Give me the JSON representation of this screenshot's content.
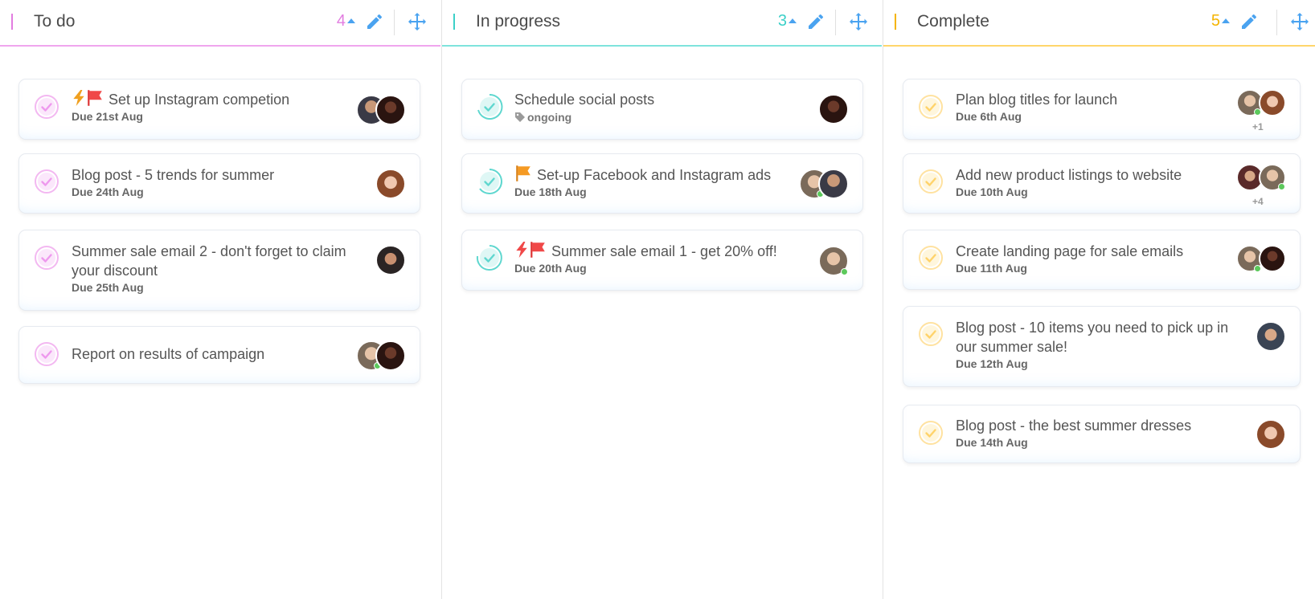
{
  "columns": [
    {
      "title": "To do",
      "count": "4",
      "accent": "#e27de0",
      "check_color": "#ee99ee",
      "cards": [
        {
          "title": "Set up Instagram competion",
          "due": "Due 21st Aug",
          "icons": [
            "lightning-icon",
            "red-flag-icon"
          ]
        },
        {
          "title": "Blog post - 5 trends for summer",
          "due": "Due 24th Aug",
          "icons": []
        },
        {
          "title_line1": "Summer sale email 2 - don't forget to claim",
          "title_line2": "your discount",
          "due": "Due 25th Aug",
          "icons": []
        },
        {
          "title": "Report on results of campaign",
          "due": "",
          "icons": []
        }
      ]
    },
    {
      "title": "In progress",
      "count": "3",
      "accent": "#3cd0c8",
      "check_color": "#5fd7cf",
      "cards": [
        {
          "title": "Schedule social posts",
          "tag": "ongoing",
          "icons": []
        },
        {
          "title": "Set-up Facebook and Instagram ads",
          "due": "Due 18th Aug",
          "icons": [
            "orange-flag-icon"
          ]
        },
        {
          "title": "Summer sale email 1 - get 20% off!",
          "due": "Due 20th Aug",
          "icons": [
            "lightning-icon",
            "red-flag-icon"
          ]
        }
      ]
    },
    {
      "title": "Complete",
      "count": "5",
      "accent": "#f5b400",
      "check_color": "#ffd36a",
      "cards": [
        {
          "title": "Plan blog titles for launch",
          "due": "Due 6th Aug",
          "more": "+1"
        },
        {
          "title": "Add new product listings to website",
          "due": "Due 10th Aug",
          "more": "+4"
        },
        {
          "title": "Create landing page for sale emails",
          "due": "Due 11th Aug"
        },
        {
          "title_line1": "Blog post - 10 items you need to pick up in",
          "title_line2": "our summer sale!",
          "due": "Due 12th Aug"
        },
        {
          "title": "Blog post - the best summer dresses",
          "due": "Due 14th Aug"
        }
      ]
    }
  ],
  "colors": {
    "header_action": "#4aa3f0",
    "online": "#5cc95c",
    "lightning": "#f0a020",
    "lightning_red": "#f04848",
    "flag_red": "#f04848",
    "flag_orange": "#f59a23"
  }
}
